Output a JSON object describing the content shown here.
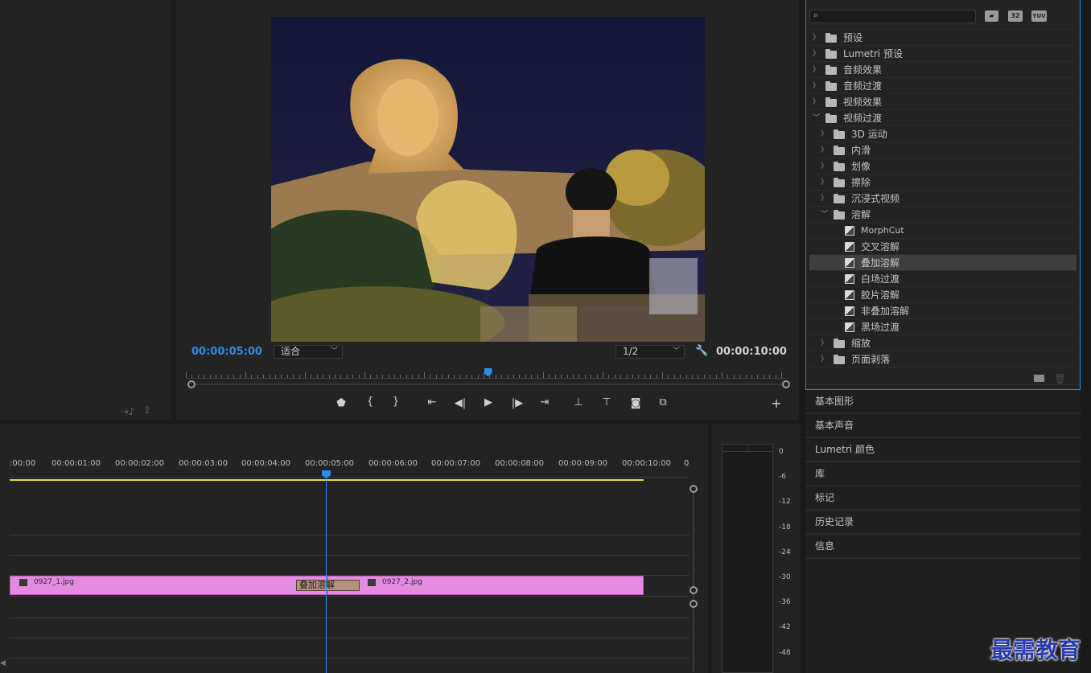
{
  "program": {
    "current_tc": "00:00:05:00",
    "fit_select": "适合",
    "res_select": "1/2",
    "duration_tc": "00:00:10:00",
    "playhead_fraction": 0.5
  },
  "effects": {
    "search_placeholder": "",
    "badges": [
      "32",
      "YUV"
    ],
    "tree": [
      {
        "label": "预设",
        "level": 0,
        "kind": "star-folder",
        "open": false
      },
      {
        "label": "Lumetri 预设",
        "level": 0,
        "kind": "star-folder",
        "open": false
      },
      {
        "label": "音频效果",
        "level": 0,
        "kind": "folder",
        "open": false
      },
      {
        "label": "音频过渡",
        "level": 0,
        "kind": "folder",
        "open": false
      },
      {
        "label": "视频效果",
        "level": 0,
        "kind": "folder",
        "open": false
      },
      {
        "label": "视频过渡",
        "level": 0,
        "kind": "folder",
        "open": true
      },
      {
        "label": "3D 运动",
        "level": 1,
        "kind": "folder",
        "open": false
      },
      {
        "label": "内滑",
        "level": 1,
        "kind": "folder",
        "open": false
      },
      {
        "label": "划像",
        "level": 1,
        "kind": "folder",
        "open": false
      },
      {
        "label": "擦除",
        "level": 1,
        "kind": "folder",
        "open": false
      },
      {
        "label": "沉浸式视频",
        "level": 1,
        "kind": "folder",
        "open": false
      },
      {
        "label": "溶解",
        "level": 1,
        "kind": "folder",
        "open": true
      },
      {
        "label": "MorphCut",
        "level": 2,
        "kind": "transition"
      },
      {
        "label": "交叉溶解",
        "level": 2,
        "kind": "transition"
      },
      {
        "label": "叠加溶解",
        "level": 2,
        "kind": "transition",
        "selected": true
      },
      {
        "label": "白场过渡",
        "level": 2,
        "kind": "transition"
      },
      {
        "label": "胶片溶解",
        "level": 2,
        "kind": "transition"
      },
      {
        "label": "非叠加溶解",
        "level": 2,
        "kind": "transition"
      },
      {
        "label": "黑场过渡",
        "level": 2,
        "kind": "transition"
      },
      {
        "label": "缩放",
        "level": 1,
        "kind": "folder",
        "open": false
      },
      {
        "label": "页面剥落",
        "level": 1,
        "kind": "folder",
        "open": false
      }
    ]
  },
  "side_panels": [
    "基本图形",
    "基本声音",
    "Lumetri 颜色",
    "库",
    "标记",
    "历史记录",
    "信息"
  ],
  "timeline": {
    "ruler": [
      ":00:00",
      "00:00:01:00",
      "00:00:02:00",
      "00:00:03:00",
      "00:00:04:00",
      "00:00:05:00",
      "00:00:06:00",
      "00:00:07:00",
      "00:00:08:00",
      "00:00:09:00",
      "00:00:10:00",
      "0"
    ],
    "clips": [
      {
        "name": "0927_1.jpg"
      },
      {
        "name": "0927_2.jpg"
      }
    ],
    "transition_label": "叠加溶解"
  },
  "meter": {
    "scale": [
      "0",
      "-6",
      "-12",
      "-18",
      "-24",
      "-30",
      "-36",
      "-42",
      "-48"
    ]
  },
  "watermark": "最需教育",
  "colors": {
    "accent": "#2d8ceb",
    "clip": "#e38ae1",
    "transition": "#b4907e",
    "work_area": "#e6dc3c"
  }
}
